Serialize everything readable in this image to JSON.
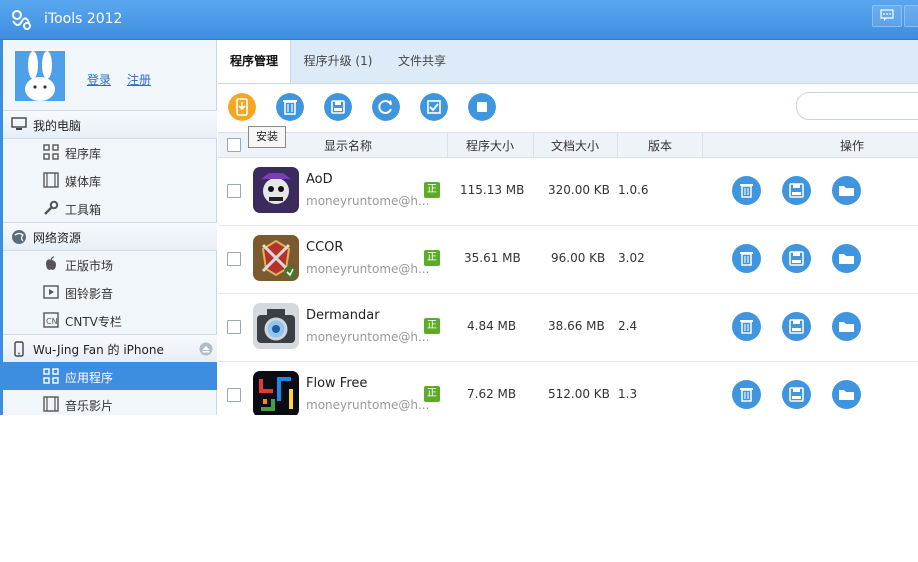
{
  "window": {
    "title": "iTools 2012"
  },
  "sidebar": {
    "login_label": "登录",
    "register_label": "注册",
    "sections": [
      {
        "label": "我的电脑",
        "icon": "computer-icon"
      },
      {
        "label": "网络资源",
        "icon": "globe-icon"
      },
      {
        "label": "Wu-Jing Fan 的 iPhone",
        "icon": "iphone-icon"
      }
    ],
    "items": [
      {
        "label": "程序库",
        "icon": "grid-icon"
      },
      {
        "label": "媒体库",
        "icon": "film-icon"
      },
      {
        "label": "工具箱",
        "icon": "wrench-icon"
      },
      {
        "label": "正版市场",
        "icon": "apple-icon"
      },
      {
        "label": "图铃影音",
        "icon": "media-icon"
      },
      {
        "label": "CNTV专栏",
        "icon": "cntv-icon"
      },
      {
        "label": "应用程序",
        "icon": "grid-icon"
      },
      {
        "label": "音乐影片",
        "icon": "film-icon"
      }
    ]
  },
  "tabs": [
    {
      "label": "程序管理"
    },
    {
      "label": "程序升级 (1)"
    },
    {
      "label": "文件共享"
    }
  ],
  "toolbar": {
    "tooltip": "安装",
    "tools": [
      "install-icon",
      "trash-icon",
      "save-icon",
      "refresh-icon",
      "check-icon",
      "stop-icon"
    ]
  },
  "table": {
    "headers": {
      "name": "显示名称",
      "size": "程序大小",
      "doc_size": "文档大小",
      "version": "版本",
      "actions": "操作"
    },
    "rows": [
      {
        "name": "AoD",
        "dev": "moneyruntome@h...",
        "badge": "正",
        "size": "115.13 MB",
        "doc_size": "320.00 KB",
        "version": "1.0.6"
      },
      {
        "name": "CCOR",
        "dev": "moneyruntome@h...",
        "badge": "正",
        "size": "35.61 MB",
        "doc_size": "96.00 KB",
        "version": "3.02"
      },
      {
        "name": "Dermandar",
        "dev": "moneyruntome@h...",
        "badge": "正",
        "size": "4.84 MB",
        "doc_size": "38.66 MB",
        "version": "2.4"
      },
      {
        "name": "Flow Free",
        "dev": "moneyruntome@h...",
        "badge": "正",
        "size": "7.62 MB",
        "doc_size": "512.00 KB",
        "version": "1.3"
      }
    ]
  },
  "colors": {
    "accent": "#3d8ee0",
    "badge": "#5cab2a",
    "action": "#3f95de",
    "install": "#f5a623"
  }
}
